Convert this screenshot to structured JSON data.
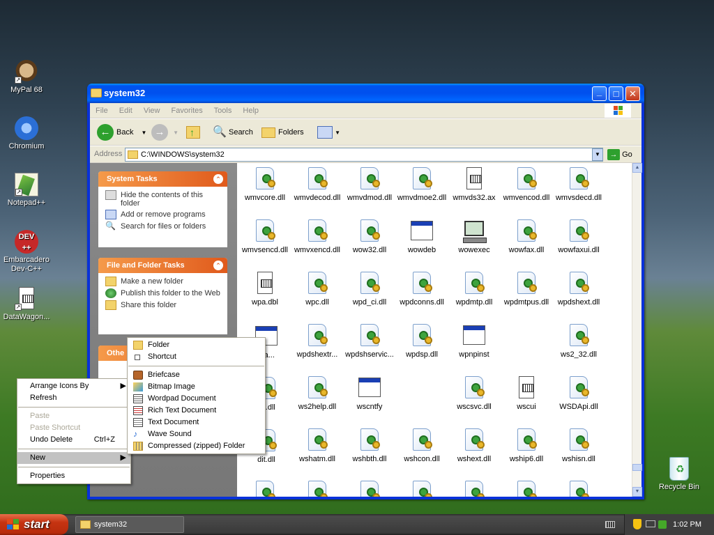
{
  "desktop": {
    "icons": [
      {
        "label": "MyPal 68"
      },
      {
        "label": "Chromium"
      },
      {
        "label": "Notepad++"
      },
      {
        "label": "Embarcadero Dev-C++"
      },
      {
        "label": "DataWagon..."
      },
      {
        "label": "Recycle Bin"
      }
    ]
  },
  "window": {
    "title": "system32",
    "controls": {
      "min": "_",
      "max": "□",
      "close": "✕"
    },
    "menu": [
      "File",
      "Edit",
      "View",
      "Favorites",
      "Tools",
      "Help"
    ],
    "toolbar": {
      "back": "Back",
      "search": "Search",
      "folders": "Folders"
    },
    "address": {
      "label": "Address",
      "value": "C:\\WINDOWS\\system32",
      "go": "Go"
    }
  },
  "tasks": {
    "system": {
      "title": "System Tasks",
      "items": [
        "Hide the contents of this folder",
        "Add or remove programs",
        "Search for files or folders"
      ]
    },
    "file": {
      "title": "File and Folder Tasks",
      "items": [
        "Make a new folder",
        "Publish this folder to the Web",
        "Share this folder"
      ]
    },
    "other": {
      "title": "Othe"
    }
  },
  "files": [
    {
      "name": "wmvcore.dll",
      "type": "dll"
    },
    {
      "name": "wmvdecod.dll",
      "type": "dll"
    },
    {
      "name": "wmvdmod.dll",
      "type": "dll"
    },
    {
      "name": "wmvdmoe2.dll",
      "type": "dll"
    },
    {
      "name": "wmvds32.ax",
      "type": "doc"
    },
    {
      "name": "wmvencod.dll",
      "type": "dll"
    },
    {
      "name": "wmvsdecd.dll",
      "type": "dll"
    },
    {
      "name": "wmvsencd.dll",
      "type": "dll"
    },
    {
      "name": "wmvxencd.dll",
      "type": "dll"
    },
    {
      "name": "wow32.dll",
      "type": "dll"
    },
    {
      "name": "wowdeb",
      "type": "exe"
    },
    {
      "name": "wowexec",
      "type": "comp"
    },
    {
      "name": "wowfax.dll",
      "type": "dll"
    },
    {
      "name": "wowfaxui.dll",
      "type": "dll"
    },
    {
      "name": "wpa.dbl",
      "type": "doc"
    },
    {
      "name": "wpc.dll",
      "type": "dll"
    },
    {
      "name": "wpd_ci.dll",
      "type": "dll"
    },
    {
      "name": "wpdconns.dll",
      "type": "dll"
    },
    {
      "name": "wpdmtp.dll",
      "type": "dll"
    },
    {
      "name": "wpdmtpus.dll",
      "type": "dll"
    },
    {
      "name": "wpdshext.dll",
      "type": "dll"
    },
    {
      "name": "wpdshextr...",
      "type": "dll"
    },
    {
      "name": "wpdshservic...",
      "type": "dll"
    },
    {
      "name": "wpdsp.dll",
      "type": "dll"
    },
    {
      "name": "wpnpinst",
      "type": "exe"
    },
    {
      "name": "ws2_32.dll",
      "type": "dll"
    },
    {
      "name": "ws2help.dll",
      "type": "dll"
    },
    {
      "name": "wscntfy",
      "type": "exe"
    },
    {
      "name": "wscsvc.dll",
      "type": "dll"
    },
    {
      "name": "wscui",
      "type": "doc"
    },
    {
      "name": "WSDApi.dll",
      "type": "dll"
    },
    {
      "name": "wshatm.dll",
      "type": "dll"
    },
    {
      "name": "wshbth.dll",
      "type": "dll"
    },
    {
      "name": "wshcon.dll",
      "type": "dll"
    },
    {
      "name": "wshext.dll",
      "type": "dll"
    },
    {
      "name": "wship6.dll",
      "type": "dll"
    },
    {
      "name": "wshisn.dll",
      "type": "dll"
    }
  ],
  "partial": {
    "xta": "xta...",
    "se": "se.dll",
    "dit": "dit.dll"
  },
  "context_menu": {
    "arrange": "Arrange Icons By",
    "refresh": "Refresh",
    "paste": "Paste",
    "paste_shortcut": "Paste Shortcut",
    "undo": "Undo Delete",
    "undo_key": "Ctrl+Z",
    "new": "New",
    "properties": "Properties"
  },
  "new_submenu": [
    "Folder",
    "Shortcut",
    "Briefcase",
    "Bitmap Image",
    "Wordpad Document",
    "Rich Text Document",
    "Text Document",
    "Wave Sound",
    "Compressed (zipped) Folder"
  ],
  "taskbar": {
    "start": "start",
    "task": "system32",
    "time": "1:02 PM"
  }
}
